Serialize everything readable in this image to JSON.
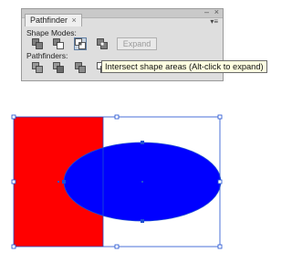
{
  "panel": {
    "minimize_glyph": "–",
    "close_glyph": "×",
    "tab_label": "Pathfinder",
    "tab_close_glyph": "×",
    "menu_glyph": "▾≡",
    "shape_modes_label": "Shape Modes:",
    "expand_label": "Expand",
    "pathfinders_label": "Pathfinders:",
    "shape_mode_tools": [
      "unite-icon",
      "minus-front-icon",
      "intersect-icon",
      "exclude-icon"
    ],
    "pathfinder_tools": [
      "divide-icon",
      "trim-icon",
      "merge-icon",
      "crop-icon",
      "outline-icon",
      "minus-back-icon"
    ],
    "active_tool": "intersect-icon"
  },
  "tooltip": {
    "text": "Intersect shape areas (Alt-click to expand)"
  },
  "artwork": {
    "rectangle_fill": "#ff0000",
    "ellipse_fill": "#0000ff",
    "selection_color": "#1f4fd1"
  }
}
